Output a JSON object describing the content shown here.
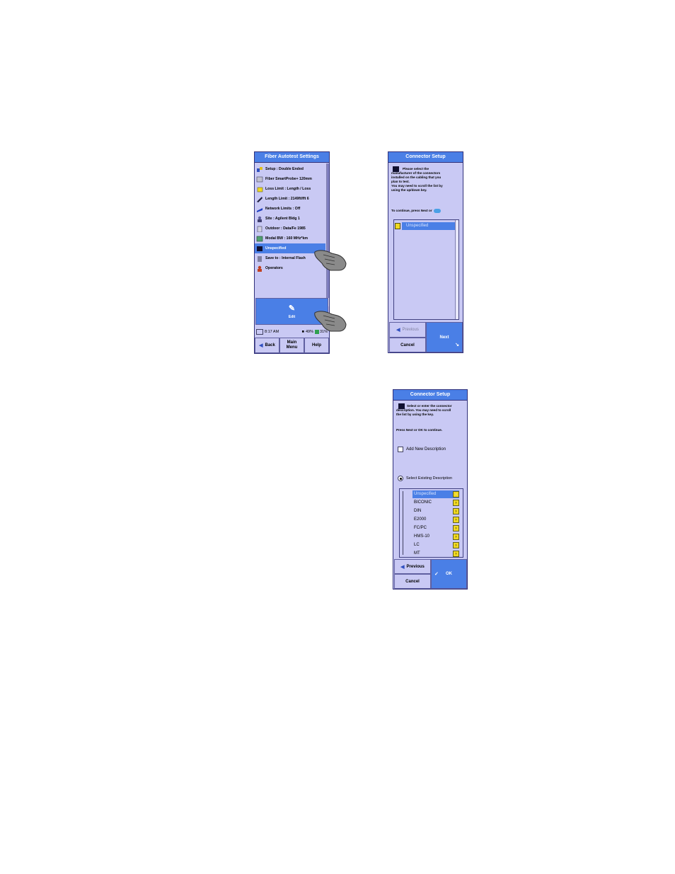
{
  "screen1": {
    "title": "Fiber Autotest Settings",
    "items": [
      {
        "label": "Setup : Double Ended",
        "icon": "setup-icon"
      },
      {
        "label": "Fiber SmartProbe+ 120mm",
        "icon": "probe-icon"
      },
      {
        "label": "Loss Limit : Length / Loss",
        "icon": "loss-limit-icon"
      },
      {
        "label": "Length Limit : 2149ft/fft  6",
        "icon": "length-limit-icon"
      },
      {
        "label": "Network Limits : Off",
        "icon": "network-limits-icon"
      },
      {
        "label": "Site : Agilent Bldg 1",
        "icon": "site-icon"
      },
      {
        "label": "Outdoor : Data/Fe 1985",
        "icon": "outdoor-icon"
      },
      {
        "label": "Modal BW : 160 MHz*km",
        "icon": "modal-bw-icon"
      },
      {
        "label": "Unspecified",
        "icon": "connector-icon",
        "selected": true
      },
      {
        "label": "Save to : Internal Flash",
        "icon": "save-icon"
      },
      {
        "label": "Operators",
        "icon": "operators-icon"
      }
    ],
    "edit_label": "Edit",
    "status": {
      "time": "8:17 AM",
      "battery1": "49%",
      "battery2": "31%"
    },
    "nav": {
      "back": "Back",
      "main_menu_line1": "Main",
      "main_menu_line2": "Menu",
      "help": "Help"
    }
  },
  "screen2": {
    "title": "Connector Setup",
    "instructions": [
      "Please select the",
      "manufacturer of the connectors",
      "installed on the cabling that you",
      "plan to test.",
      "You may need to scroll the list by",
      "using the up/down key."
    ],
    "continue_text": "To continue, press Next or",
    "list_item": "Unspecified",
    "previous": "Previous",
    "next": "Next",
    "cancel": "Cancel"
  },
  "screen3": {
    "title": "Connector Setup",
    "instructions": [
      "Select or enter the connector",
      "description. You may need to scroll",
      "the list by using the key."
    ],
    "press_text": "Press Next or OK to continue.",
    "option_add": "Add New Description",
    "option_select": "Select Existing Description",
    "list": [
      "Unspecified",
      "BICONIC",
      "DIN",
      "E2000",
      "FC/PC",
      "HMS-10",
      "LC",
      "MT"
    ],
    "previous": "Previous",
    "ok": "OK",
    "cancel": "Cancel"
  },
  "colors": {
    "screen_bg": "#c9c9f4",
    "accent": "#4a7fe6",
    "border": "#30307a"
  }
}
